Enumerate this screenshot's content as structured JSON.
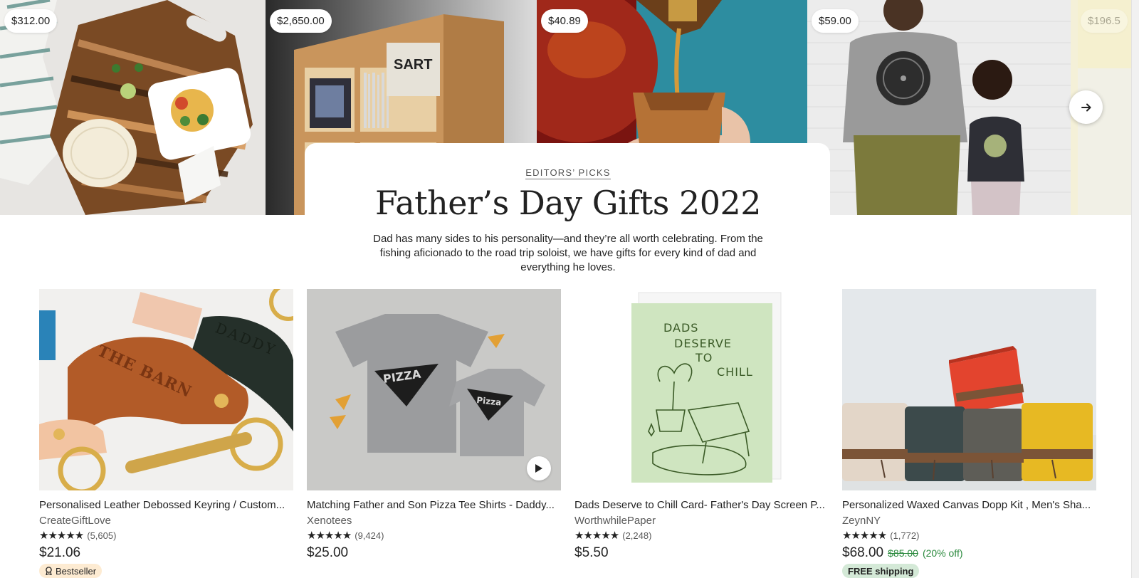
{
  "hero": {
    "prices": [
      "$312.00",
      "$2,650.00",
      "$40.89",
      "$59.00",
      "$196.5"
    ],
    "eyebrow": "EDITORS’ PICKS",
    "title": "Father’s Day Gifts 2022",
    "intro": "Dad has many sides to his personality—and they’re all worth celebrating. From the fishing aficionado to the road trip soloist, we have gifts for every kind of dad and everything he loves.",
    "next_icon": "arrow-right-icon",
    "sart_text": "SART"
  },
  "products": [
    {
      "title": "Personalised Leather Debossed Keyring / Custom...",
      "shop": "CreateGiftLove",
      "stars": "★★★★★",
      "reviews": "(5,605)",
      "price": "$21.06",
      "badge": "Bestseller",
      "img_words": [
        "THE BARN",
        "DADDY"
      ]
    },
    {
      "title": "Matching Father and Son Pizza Tee Shirts - Daddy...",
      "shop": "Xenotees",
      "stars": "★★★★★",
      "reviews": "(9,424)",
      "price": "$25.00",
      "img_words": [
        "PIZZA",
        "Pizza"
      ]
    },
    {
      "title": "Dads Deserve to Chill Card- Father's Day Screen P...",
      "shop": "WorthwhilePaper",
      "stars": "★★★★★",
      "reviews": "(2,248)",
      "price": "$5.50",
      "img_words": [
        "DADS",
        "DESERVE",
        "TO",
        "CHILL"
      ]
    },
    {
      "title": "Personalized Waxed Canvas Dopp Kit , Men's Sha...",
      "shop": "ZeynNY",
      "stars": "★★★★★",
      "reviews": "(1,772)",
      "price": "$68.00",
      "original_price": "$85.00",
      "discount": "(20% off)",
      "badge": "FREE shipping"
    }
  ],
  "colors": {
    "discount_green": "#2b8a3e",
    "bestseller_bg": "#fdebd2",
    "free_ship_bg": "#d4e9d7"
  }
}
